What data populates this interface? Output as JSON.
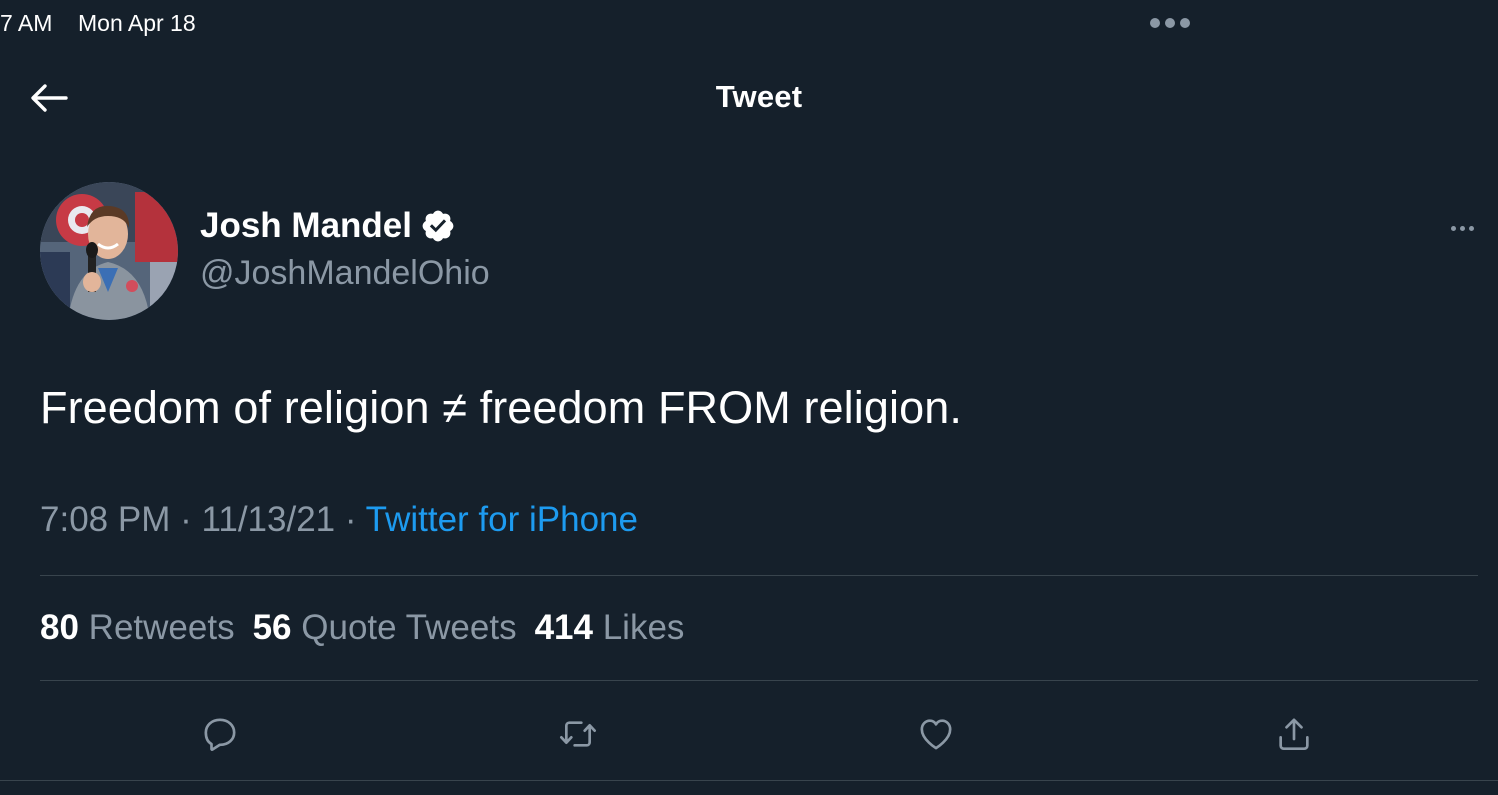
{
  "status_bar": {
    "time": "7 AM",
    "date": "Mon Apr 18"
  },
  "nav": {
    "back_icon": "arrow-left-icon",
    "title": "Tweet"
  },
  "author": {
    "name": "Josh Mandel",
    "handle": "@JoshMandelOhio",
    "verified_icon": "verified-badge-icon"
  },
  "tweet": {
    "text": "Freedom of religion ≠ freedom FROM religion.",
    "time": "7:08 PM",
    "date": "11/13/21",
    "separator": "·",
    "source": "Twitter for iPhone"
  },
  "stats": {
    "retweets_count": "80",
    "retweets_label": "Retweets",
    "quotes_count": "56",
    "quotes_label": "Quote Tweets",
    "likes_count": "414",
    "likes_label": "Likes"
  },
  "actions": {
    "reply_icon": "reply-icon",
    "retweet_icon": "retweet-icon",
    "like_icon": "heart-icon",
    "share_icon": "share-icon"
  },
  "colors": {
    "background": "#15202b",
    "primary_text": "#ffffff",
    "secondary_text": "#8b98a5",
    "accent": "#1d9bf0",
    "divider": "#38444d"
  }
}
